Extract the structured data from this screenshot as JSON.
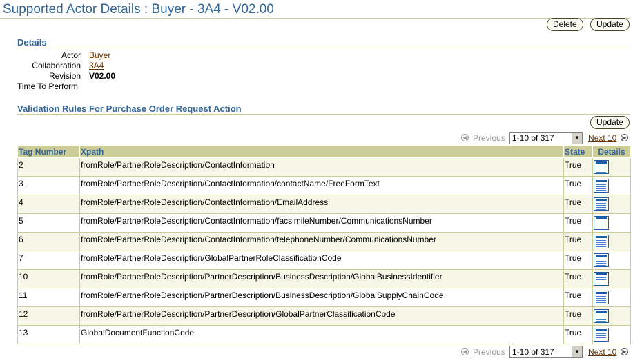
{
  "page": {
    "title": "Supported Actor Details : Buyer - 3A4 - V02.00",
    "delete_label": "Delete",
    "update_label": "Update"
  },
  "details": {
    "heading": "Details",
    "fields": [
      {
        "label": "Actor",
        "value": "Buyer"
      },
      {
        "label": "Collaboration",
        "value": "3A4"
      },
      {
        "label": "Revision",
        "value": "V02.00"
      },
      {
        "label": "Time To Perform",
        "value": ""
      }
    ]
  },
  "rules": {
    "heading": "Validation Rules For Purchase Order Request Action",
    "update_label": "Update",
    "pager": {
      "previous_label": "Previous",
      "range": "1-10 of 317",
      "next_label": "Next 10"
    },
    "columns": [
      "Tag Number",
      "Xpath",
      "State",
      "Details"
    ],
    "rows": [
      {
        "tag": "2",
        "xpath": "fromRole/PartnerRoleDescription/ContactInformation",
        "state": "True"
      },
      {
        "tag": "3",
        "xpath": "fromRole/PartnerRoleDescription/ContactInformation/contactName/FreeFormText",
        "state": "True"
      },
      {
        "tag": "4",
        "xpath": "fromRole/PartnerRoleDescription/ContactInformation/EmailAddress",
        "state": "True"
      },
      {
        "tag": "5",
        "xpath": "fromRole/PartnerRoleDescription/ContactInformation/facsimileNumber/CommunicationsNumber",
        "state": "True"
      },
      {
        "tag": "6",
        "xpath": "fromRole/PartnerRoleDescription/ContactInformation/telephoneNumber/CommunicationsNumber",
        "state": "True"
      },
      {
        "tag": "7",
        "xpath": "fromRole/PartnerRoleDescription/GlobalPartnerRoleClassificationCode",
        "state": "True"
      },
      {
        "tag": "10",
        "xpath": "fromRole/PartnerRoleDescription/PartnerDescription/BusinessDescription/GlobalBusinessIdentifier",
        "state": "True"
      },
      {
        "tag": "11",
        "xpath": "fromRole/PartnerRoleDescription/PartnerDescription/BusinessDescription/GlobalSupplyChainCode",
        "state": "True"
      },
      {
        "tag": "12",
        "xpath": "fromRole/PartnerRoleDescription/PartnerDescription/GlobalPartnerClassificationCode",
        "state": "True"
      },
      {
        "tag": "13",
        "xpath": "GlobalDocumentFunctionCode",
        "state": "True"
      }
    ]
  },
  "icons": {
    "previous": "previous-arrow-icon",
    "next": "next-arrow-icon",
    "details": "details-icon",
    "dropdown": "chevron-down-icon"
  },
  "colors": {
    "title": "#336699",
    "header_bg": "#cccc99",
    "link": "#663300",
    "icon_blue": "#1f5aa6"
  }
}
